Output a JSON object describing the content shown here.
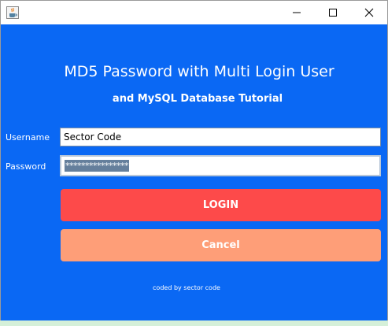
{
  "window": {
    "app_icon": "java-cup-icon",
    "controls": {
      "minimize": "minimize-icon",
      "maximize": "maximize-icon",
      "close": "close-icon"
    }
  },
  "header": {
    "title": "MD5 Password with Multi Login User",
    "subtitle": "and MySQL Database Tutorial"
  },
  "form": {
    "username_label": "Username",
    "username_value": "Sector Code",
    "password_label": "Password",
    "password_value": "****************"
  },
  "buttons": {
    "login_label": "LOGIN",
    "cancel_label": "Cancel"
  },
  "footer": {
    "credit": "coded by sector code"
  },
  "colors": {
    "background": "#0a68f4",
    "login_button": "#fd4a4a",
    "cancel_button": "#fe9e78",
    "text": "#ffffff"
  }
}
